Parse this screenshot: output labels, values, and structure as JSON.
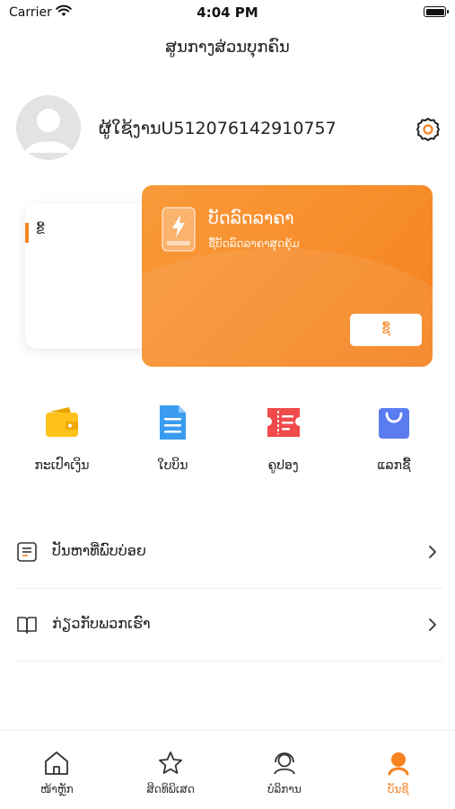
{
  "status_bar": {
    "carrier": "Carrier",
    "time": "4:04 PM"
  },
  "page": {
    "title": "ສູນກາງສ່ວນບຸກຄົນ"
  },
  "profile": {
    "username": "ຜູ້ໃຊ້ງານU512076142910757"
  },
  "vip_card": {
    "back_label": "ຂີ້",
    "title": "ບັດລົດລາຄາ",
    "subtitle": "ຊື້ບັດລົດລາຄາສຸດຄຸ້ມ",
    "button_label": "ຊື້",
    "accent_color": "#f5821f"
  },
  "quick_actions": [
    {
      "label": "ກະເປົາເງິນ",
      "icon": "wallet-icon"
    },
    {
      "label": "ໃບບິນ",
      "icon": "document-icon"
    },
    {
      "label": "ຄູປອງ",
      "icon": "coupon-icon"
    },
    {
      "label": "ແລກຊື້",
      "icon": "shopping-bag-icon"
    }
  ],
  "menu": [
    {
      "label": "ປັນຫາທີ່ພົບບ່ອຍ",
      "icon": "faq-icon"
    },
    {
      "label": "ກ່ຽວກັບພວກເຮົາ",
      "icon": "book-icon"
    }
  ],
  "tabs": [
    {
      "label": "ໜ້າຫຼັກ",
      "icon": "home-icon",
      "active": false
    },
    {
      "label": "ສິດທິພິເສດ",
      "icon": "star-icon",
      "active": false
    },
    {
      "label": "ບໍລິການ",
      "icon": "support-icon",
      "active": false
    },
    {
      "label": "ບັນຊີ",
      "icon": "profile-icon",
      "active": true
    }
  ]
}
